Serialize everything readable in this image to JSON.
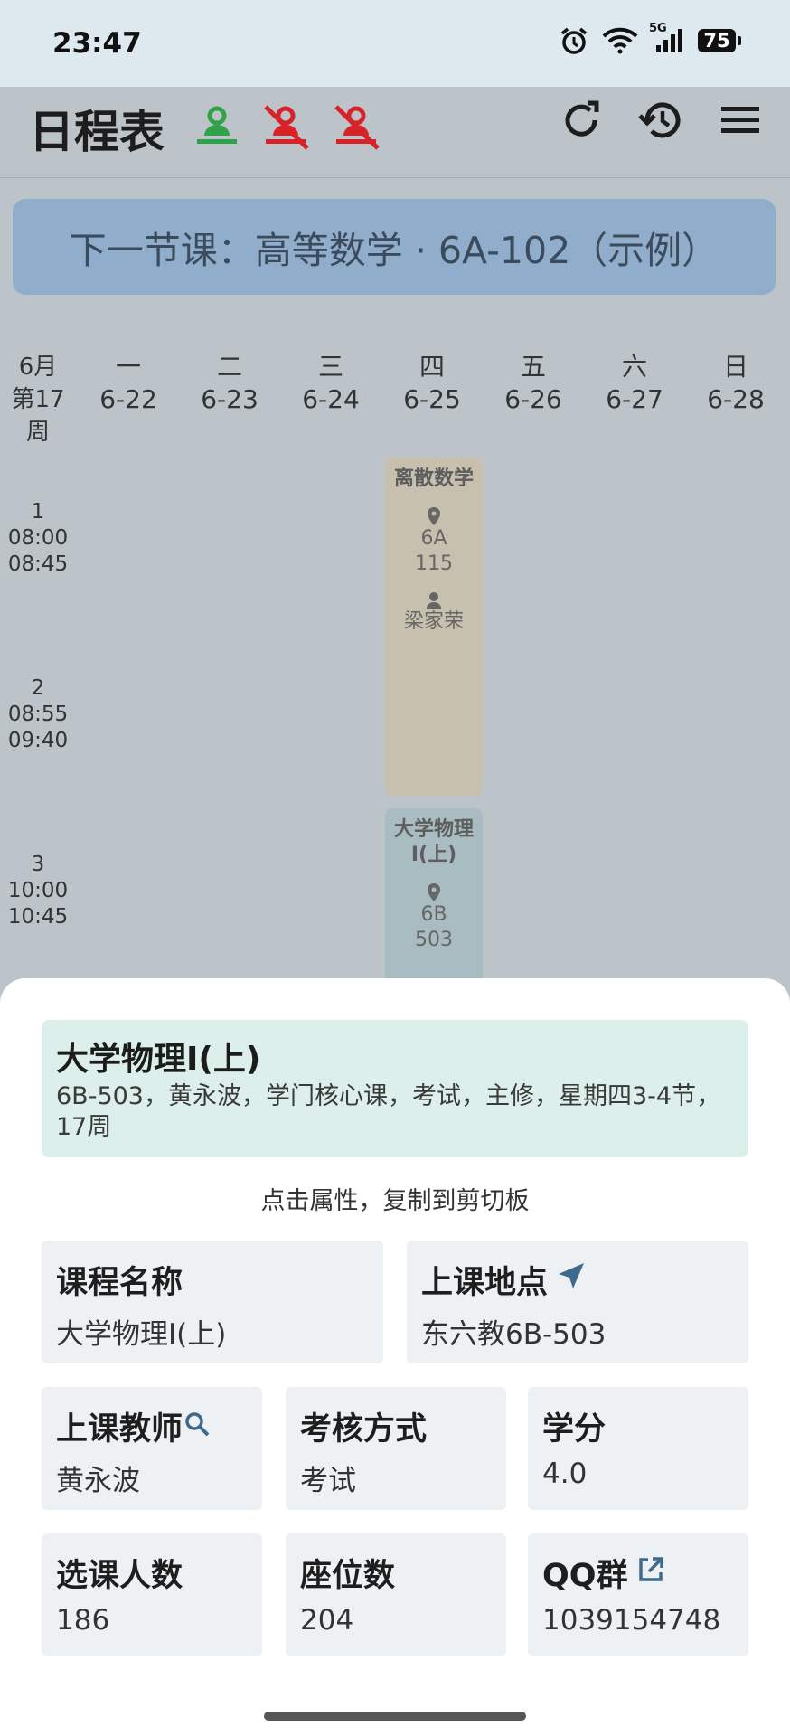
{
  "status": {
    "time": "23:47",
    "battery": "75",
    "network": "5G"
  },
  "appbar": {
    "title": "日程表"
  },
  "banner": {
    "text": "下一节课：高等数学 · 6A-102（示例）"
  },
  "header": {
    "month": "6月",
    "week": "第17周",
    "days": [
      {
        "weekday": "一",
        "date": "6-22"
      },
      {
        "weekday": "二",
        "date": "6-23"
      },
      {
        "weekday": "三",
        "date": "6-24"
      },
      {
        "weekday": "四",
        "date": "6-25"
      },
      {
        "weekday": "五",
        "date": "6-26"
      },
      {
        "weekday": "六",
        "date": "6-27"
      },
      {
        "weekday": "日",
        "date": "6-28"
      }
    ]
  },
  "periods": [
    {
      "num": "1",
      "start": "08:00",
      "end": "08:45"
    },
    {
      "num": "2",
      "start": "08:55",
      "end": "09:40"
    },
    {
      "num": "3",
      "start": "10:00",
      "end": "10:45"
    }
  ],
  "courses": [
    {
      "name": "离散数学",
      "room_a": "6A",
      "room_b": "115",
      "teacher": "梁家荣",
      "color": "#c8c0ae"
    },
    {
      "name": "大学物理I(上)",
      "room_a": "6B",
      "room_b": "503",
      "color": "#a9bcc2"
    }
  ],
  "detail": {
    "title": "大学物理I(上)",
    "description": "6B-503，黄永波，学门核心课，考试，主修，星期四3-4节，17周",
    "hint": "点击属性，复制到剪切板",
    "fields": {
      "course_name": {
        "label": "课程名称",
        "value": "大学物理I(上)"
      },
      "location": {
        "label": "上课地点",
        "value": "东六教6B-503"
      },
      "teacher": {
        "label": "上课教师",
        "value": "黄永波"
      },
      "exam": {
        "label": "考核方式",
        "value": "考试"
      },
      "credit": {
        "label": "学分",
        "value": "4.0"
      },
      "enrolled": {
        "label": "选课人数",
        "value": "186"
      },
      "seats": {
        "label": "座位数",
        "value": "204"
      },
      "qq": {
        "label": "QQ群",
        "value": "1039154748"
      }
    }
  },
  "colors": {
    "accent": "#3f6a8c",
    "green": "#2fa24a",
    "red": "#d8222a"
  }
}
